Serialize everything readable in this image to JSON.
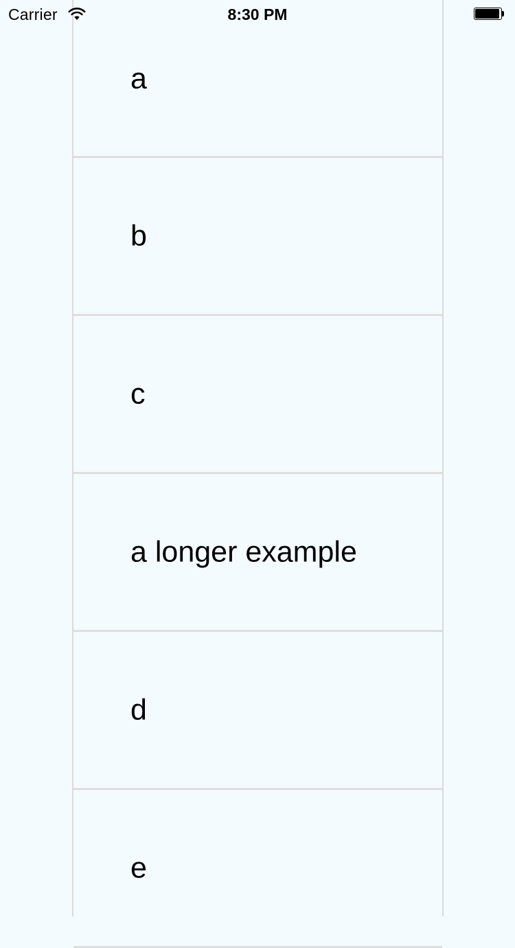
{
  "status_bar": {
    "carrier": "Carrier",
    "time": "8:30 PM",
    "wifi_icon": "wifi-icon",
    "battery_icon": "battery-icon"
  },
  "list": {
    "items": [
      {
        "label": "a"
      },
      {
        "label": "b"
      },
      {
        "label": "c"
      },
      {
        "label": "a longer example"
      },
      {
        "label": "d"
      },
      {
        "label": "e"
      }
    ]
  }
}
